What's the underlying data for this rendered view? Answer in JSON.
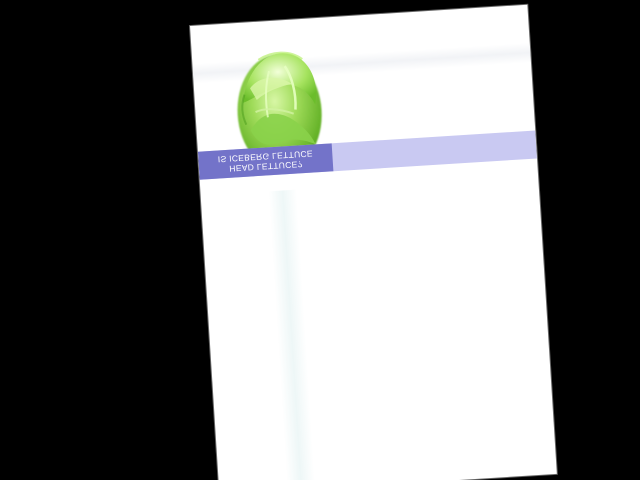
{
  "colors": {
    "background": "#000000",
    "sheet": "#ffffff",
    "banner_light": "#c9c9f2",
    "banner_dark": "#7373c9",
    "banner_text": "#ffffff",
    "lettuce_green": "#8fd14f"
  },
  "image": {
    "icon": "lettuce-icon"
  },
  "banner": {
    "line1": "HEAD LETTUCE?",
    "line2": "IS ICEBERG LETTUCE"
  }
}
